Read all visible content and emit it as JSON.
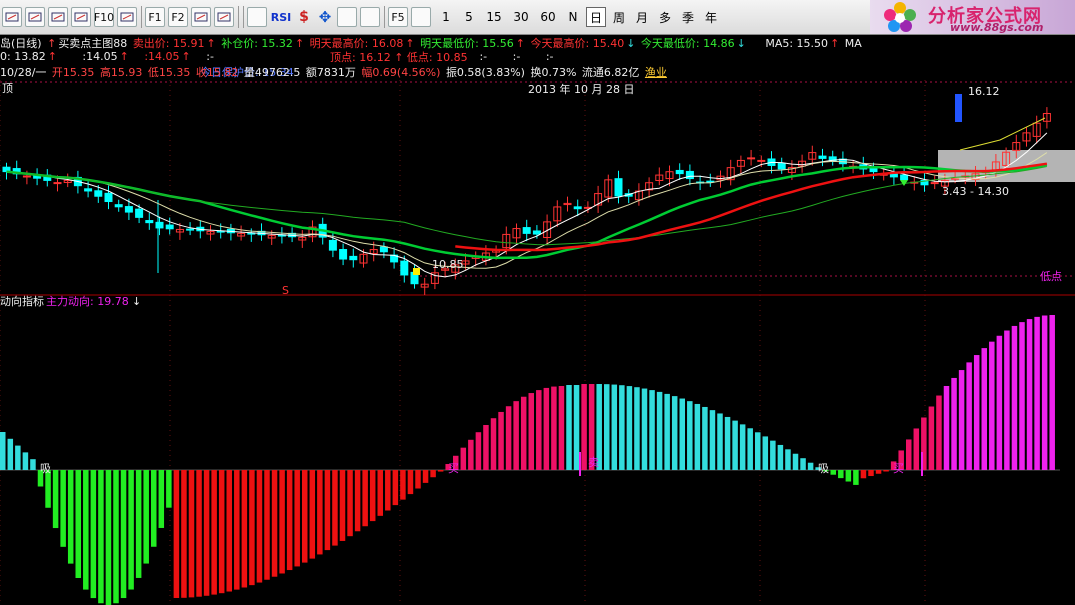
{
  "toolbar": {
    "icons": [
      "kline-icon",
      "trend-line-icon",
      "bar-chart-icon",
      "table-icon",
      "f10-icon",
      "news-icon",
      "f1-icon",
      "f2-icon",
      "calculator-icon",
      "zoom-icon"
    ],
    "icon_labels": [
      "",
      "",
      "",
      "",
      "F10",
      "",
      "F1",
      "F2",
      "",
      ""
    ],
    "indicator_label": "RSI",
    "f5_label": "F5",
    "periods": [
      "1",
      "5",
      "15",
      "30",
      "60",
      "N",
      "日",
      "周",
      "月",
      "多",
      "季",
      "年"
    ],
    "active_period": "日"
  },
  "logo": {
    "brand": "分析家公式网",
    "url": "www.88gs.com"
  },
  "info_row1": {
    "title": "岛(日线)",
    "formula": "买卖点主图88",
    "sell_label": "卖出价: 15.91",
    "add_label": "补仓价: 15.32",
    "tomorrow_high": "明天最高价: 16.08",
    "tomorrow_low": "明天最低价: 15.56",
    "today_high": "今天最高价: 15.40",
    "today_low": "今天最低价: 14.86",
    "ma5": "MA5: 15.50",
    "ma_more": "MA"
  },
  "info_row2": {
    "v1": "0: 13.82",
    "v2": ":14.05",
    "v3": ":14.05",
    "v4": ":-",
    "v5": ":-",
    "v6": ":-",
    "v7": ":-"
  },
  "info_row3": {
    "protect": "今日保护价: 15.34",
    "top": "顶点: 16.12",
    "low": "低点: 10.85"
  },
  "info_row4": {
    "date": "10/28/一",
    "open": "开15.35",
    "high": "高15.93",
    "low": "低15.35",
    "close": "收15.82",
    "vol": "量49762.5",
    "amount": "额7831万",
    "range": "幅0.69(4.56%)",
    "amp": "振0.58(3.83%)",
    "turnover": "换0.73%",
    "float": "流通6.82亿",
    "industry": "渔业"
  },
  "price_chart": {
    "top_label": "顶",
    "date_label": "2013 年 10 月 28 日",
    "high_label": "16.12",
    "low_label": "低点",
    "box_label": "3.43 - 14.30",
    "s_marker": "S",
    "low_value_label": "10.85"
  },
  "indicator": {
    "name": "动向指标",
    "line_label": "主力动向: 19.78",
    "buy_marker": "买",
    "sell_marker": "卖",
    "mid_marker": "吸"
  },
  "colors": {
    "up": "#ff3333",
    "down": "#00ffff",
    "ma_white": "#ffffff",
    "ma_green": "#00cc33",
    "ma_red": "#ee1111",
    "hist_cyan": "#33dddd",
    "hist_green": "#22ee22",
    "hist_red": "#ee1111",
    "hist_pink": "#ee1166",
    "hist_magenta": "#ee22ee"
  }
}
